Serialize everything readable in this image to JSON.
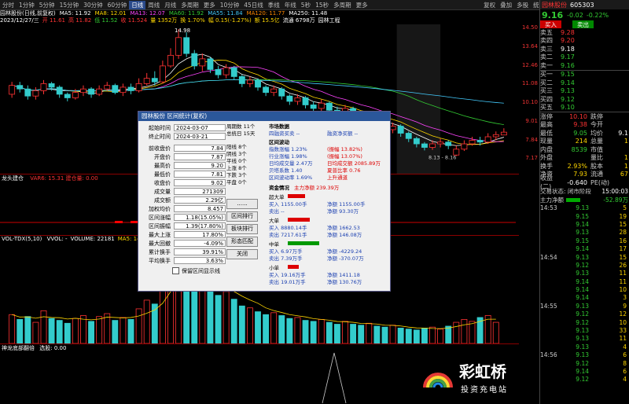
{
  "toolbar": {
    "timeframes": [
      "分时",
      "1分钟",
      "5分钟",
      "15分钟",
      "30分钟",
      "60分钟",
      "日线",
      "周线",
      "月线",
      "多周期",
      "更多"
    ],
    "active_index": 6,
    "middle": [
      "10分钟",
      "45日线",
      "季线",
      "年线",
      "5秒",
      "15秒",
      "多周期",
      "更多"
    ],
    "right_tools": [
      "复权",
      "叠加",
      "多股",
      "统计",
      "画线",
      "F10",
      "标记",
      "自选",
      "返回"
    ]
  },
  "ma_line": {
    "items": [
      {
        "text": "园林股份(日线,前复权)",
        "color": "#ffffff"
      },
      {
        "text": "MA5: 11.92",
        "color": "#ffffff"
      },
      {
        "text": "MA8: 12.01",
        "color": "#ffd700"
      },
      {
        "text": "MA13: 12.07",
        "color": "#ff44ff"
      },
      {
        "text": "MA60: 11.92",
        "color": "#33cc33"
      },
      {
        "text": "MA55: 11.84",
        "color": "#44ccff"
      },
      {
        "text": "MA120: 11.77",
        "color": "#ff8800"
      },
      {
        "text": "MA250: 11.48",
        "color": "#ffffff"
      }
    ]
  },
  "info_line": {
    "date": "2023/12/27/三",
    "items": [
      {
        "text": "开 11.61",
        "color": "#ff3333"
      },
      {
        "text": "高 11.82",
        "color": "#ff3333"
      },
      {
        "text": "低 11.52",
        "color": "#33cc33"
      },
      {
        "text": "收 11.524",
        "color": "#ff3333"
      },
      {
        "text": "量 1352万",
        "color": "#ffd700"
      },
      {
        "text": "换 1.70%",
        "color": "#ffd700"
      },
      {
        "text": "幅 0.15(-1.27%)",
        "color": "#ffd700"
      },
      {
        "text": "额 15.5亿",
        "color": "#ffd700"
      },
      {
        "text": "流通 6798万",
        "color": "#ffffff"
      },
      {
        "text": "园林工程",
        "color": "#ffffff"
      }
    ]
  },
  "price_axis": [
    "14.50",
    "13.64",
    "12.46",
    "11.08",
    "10.10",
    "9.01",
    "7.84",
    "7.17"
  ],
  "annotations": {
    "high_marker": "14.98",
    "low_marker": "8.13 - 8.16"
  },
  "panel2": {
    "title": "龙头建仓",
    "value": "VAR6: 15.31 建仓量: 0.00"
  },
  "panel3": {
    "title": "VOL-TDX(5,10)",
    "values": [
      {
        "text": "VVOL: -",
        "color": "#ffffff"
      },
      {
        "text": "VOLUME: 22181",
        "color": "#ffffff"
      },
      {
        "text": "MA5: 14656",
        "color": "#ffd700"
      },
      {
        "text": "MA10: 19...",
        "color": "#ff44ff"
      }
    ]
  },
  "panel4": {
    "title": "神龙底部翻倍",
    "value": "选股: 0.00"
  },
  "stock": {
    "name": "园林股份",
    "code": "605303",
    "price": "9.16",
    "change": "-0.02",
    "pct": "-0.22%"
  },
  "order_book": {
    "asks": [
      {
        "label": "卖五",
        "price": "9.28",
        "vol": "",
        "color": "#ff3333"
      },
      {
        "label": "卖四",
        "price": "9.20",
        "vol": "",
        "color": "#ff3333"
      },
      {
        "label": "卖三",
        "price": "9.18",
        "vol": "",
        "color": "#ffffff"
      },
      {
        "label": "卖二",
        "price": "9.17",
        "vol": "",
        "color": "#33cc33"
      },
      {
        "label": "卖一",
        "price": "9.16",
        "vol": "",
        "color": "#33cc33"
      }
    ],
    "bids": [
      {
        "label": "买一",
        "price": "9.15",
        "vol": "",
        "color": "#33cc33"
      },
      {
        "label": "买二",
        "price": "9.14",
        "vol": "",
        "color": "#33cc33"
      },
      {
        "label": "买三",
        "price": "9.13",
        "vol": "",
        "color": "#33cc33"
      },
      {
        "label": "买四",
        "price": "9.12",
        "vol": "",
        "color": "#33cc33"
      },
      {
        "label": "买五",
        "price": "9.10",
        "vol": "",
        "color": "#33cc33"
      }
    ]
  },
  "stats": [
    {
      "k": "涨停",
      "v": "10.10",
      "vc": "#ff3333",
      "k2": "跌停",
      "v2": "",
      "v2c": "#33cc33"
    },
    {
      "k": "最高",
      "v": "9.38",
      "vc": "#ff3333",
      "k2": "今开",
      "v2": "",
      "v2c": "#ff3333"
    },
    {
      "k": "最低",
      "v": "9.05",
      "vc": "#33cc33",
      "k2": "均价",
      "v2": "9.1",
      "v2c": "#ffffff"
    },
    {
      "k": "现量",
      "v": "214",
      "vc": "#ffd700",
      "k2": "总量",
      "v2": "1",
      "v2c": "#ffd700"
    },
    {
      "k": "内盘",
      "v": "8539",
      "vc": "#33cc33",
      "k2": "市值",
      "v2": "",
      "v2c": "#ffd700"
    },
    {
      "k": "外盘",
      "v": "",
      "vc": "#ff3333",
      "k2": "量比",
      "v2": "1",
      "v2c": "#ffd700"
    },
    {
      "k": "换手",
      "v": "2.93%",
      "vc": "#ffd700",
      "k2": "股本",
      "v2": "1",
      "v2c": "#ffd700"
    },
    {
      "k": "净资",
      "v": "7.93",
      "vc": "#ffd700",
      "k2": "流通",
      "v2": "67",
      "v2c": "#ffd700"
    },
    {
      "k": "收益(二)",
      "v": "-0.640",
      "vc": "#ffffff",
      "k2": "PE(动)",
      "v2": "",
      "v2c": "#ffffff"
    }
  ],
  "trade_status": {
    "label": "交易状态: 闭市阶段",
    "time": "15:00:03"
  },
  "main_flow": {
    "label": "主力净额",
    "value": "-52.89万"
  },
  "ticks": [
    {
      "t": "14:53",
      "p": "9.13",
      "v": "5"
    },
    {
      "t": "",
      "p": "9.15",
      "v": "19"
    },
    {
      "t": "",
      "p": "9.14",
      "v": "15"
    },
    {
      "t": "",
      "p": "9.13",
      "v": "28"
    },
    {
      "t": "",
      "p": "9.15",
      "v": "16"
    },
    {
      "t": "",
      "p": "9.14",
      "v": "17"
    },
    {
      "t": "14:54",
      "p": "9.13",
      "v": "15"
    },
    {
      "t": "",
      "p": "9.12",
      "v": "26"
    },
    {
      "t": "",
      "p": "9.13",
      "v": "11"
    },
    {
      "t": "",
      "p": "9.14",
      "v": "11"
    },
    {
      "t": "",
      "p": "9.14",
      "v": "10"
    },
    {
      "t": "",
      "p": "9.14",
      "v": "3"
    },
    {
      "t": "14:55",
      "p": "9.13",
      "v": "9"
    },
    {
      "t": "",
      "p": "9.12",
      "v": "12"
    },
    {
      "t": "",
      "p": "9.12",
      "v": "10"
    },
    {
      "t": "",
      "p": "9.13",
      "v": "33"
    },
    {
      "t": "",
      "p": "9.13",
      "v": "11"
    },
    {
      "t": "",
      "p": "9.13",
      "v": "4"
    },
    {
      "t": "14:56",
      "p": "9.13",
      "v": "6"
    },
    {
      "t": "",
      "p": "9.12",
      "v": "8"
    },
    {
      "t": "",
      "p": "9.14",
      "v": "6"
    },
    {
      "t": "",
      "p": "9.12",
      "v": "4"
    }
  ],
  "dialog": {
    "title": "园林股份 区间统计(复权)",
    "fields": [
      {
        "label": "起始时间",
        "value": "2024-03-07"
      },
      {
        "label": "终止时间",
        "value": "2024-03-21"
      }
    ],
    "rows": [
      {
        "label": "前收盘价",
        "value": "7.84"
      },
      {
        "label": "开盘价",
        "value": "7.87"
      },
      {
        "label": "最高价",
        "value": "9.20"
      },
      {
        "label": "最低价",
        "value": "7.81"
      },
      {
        "label": "收盘价",
        "value": "9.02"
      },
      {
        "label": "成交量",
        "value": "271309"
      },
      {
        "label": "成交额",
        "value": "2.29亿"
      },
      {
        "label": "加权均价",
        "value": "8.457"
      },
      {
        "label": "区间涨幅",
        "value": "1.18(15.05%)"
      },
      {
        "label": "区间振幅",
        "value": "1.39(17.80%)"
      },
      {
        "label": "最大上涨",
        "value": "17.80%"
      },
      {
        "label": "最大回撤",
        "value": "-4.09%"
      },
      {
        "label": "累计换手",
        "value": "39.91%"
      },
      {
        "label": "平均换手",
        "value": "3.63%"
      }
    ],
    "checkbox": "保留区间显示线",
    "period": [
      "周期数 11个",
      "总统日 15天"
    ],
    "counts": [
      "阳线 8个",
      "阴线 3个",
      "平线 0个",
      "上涨 8个",
      "下跌 3个",
      "平盘 0个"
    ],
    "buttons": [
      "......",
      "区间排行",
      "板块排行",
      "形态匹配",
      "关闭"
    ],
    "market_title": "市场数据",
    "market_sub": [
      "四融资买卖 --",
      "融资净买额 --"
    ],
    "interval_title": "区间波动",
    "interval": [
      {
        "a": "指数涨幅 1.23%",
        "b": "(振幅 13.82%)"
      },
      {
        "a": "行业涨幅 1.98%",
        "b": "(振幅 13.07%)"
      },
      {
        "a": "日均成交量 2.47万",
        "b": "日均成交额 2085.89万"
      },
      {
        "a": "贝塔系数 1.40",
        "b": "夏普比率 0.76"
      },
      {
        "a": "区间波动率 1.69%",
        "b": "上升通道"
      }
    ],
    "capital_title": "资金情况",
    "capital_main": "主力净额 239.39万",
    "blocks": [
      {
        "name": "超大单",
        "buy": "买入 1155.00手",
        "sell": "卖出 --",
        "net_label": "净额 1155.00手",
        "net2": "净额 93.30万",
        "color": "#dd0000",
        "barw": 22
      },
      {
        "name": "大单",
        "buy": "买入 8880.14手",
        "sell": "卖出 7217.61手",
        "net_label": "净额 1662.53",
        "net2": "净额 146.08万",
        "color": "#dd0000",
        "barw": 28
      },
      {
        "name": "中单",
        "buy": "买入 6.97万手",
        "sell": "卖出 7.39万手",
        "net_label": "净额 -4229.24",
        "net2": "净额 -370.07万",
        "color": "#009900",
        "barw": 40
      },
      {
        "name": "小单",
        "buy": "买入 19.16万手",
        "sell": "卖出 19.01万手",
        "net_label": "净额 1411.18",
        "net2": "净额 130.76万",
        "color": "#dd0000",
        "barw": 14
      }
    ]
  },
  "watermark": {
    "title": "彩虹桥",
    "subtitle": "投资充电站"
  },
  "chart_data": {
    "type": "candlestick",
    "title": "园林股份(日线,前复权)",
    "ylim": [
      7.17,
      14.98
    ],
    "candles": [
      {
        "o": 11.3,
        "c": 11.8,
        "h": 12.0,
        "l": 11.1
      },
      {
        "o": 11.8,
        "c": 11.6,
        "h": 12.0,
        "l": 11.4
      },
      {
        "o": 11.6,
        "c": 11.2,
        "h": 11.8,
        "l": 11.0
      },
      {
        "o": 11.2,
        "c": 11.5,
        "h": 11.7,
        "l": 11.0
      },
      {
        "o": 11.5,
        "c": 11.9,
        "h": 12.1,
        "l": 11.3
      },
      {
        "o": 11.9,
        "c": 11.7,
        "h": 12.0,
        "l": 11.5
      },
      {
        "o": 11.7,
        "c": 11.3,
        "h": 11.8,
        "l": 11.1
      },
      {
        "o": 11.3,
        "c": 11.1,
        "h": 11.4,
        "l": 10.9
      },
      {
        "o": 11.1,
        "c": 11.4,
        "h": 11.6,
        "l": 11.0
      },
      {
        "o": 11.4,
        "c": 11.6,
        "h": 11.8,
        "l": 11.2
      },
      {
        "o": 11.6,
        "c": 11.3,
        "h": 11.7,
        "l": 11.1
      },
      {
        "o": 11.3,
        "c": 11.6,
        "h": 11.8,
        "l": 11.2
      },
      {
        "o": 11.6,
        "c": 11.8,
        "h": 12.0,
        "l": 11.5
      },
      {
        "o": 11.8,
        "c": 11.4,
        "h": 11.9,
        "l": 11.3
      },
      {
        "o": 11.4,
        "c": 11.7,
        "h": 11.9,
        "l": 11.2
      },
      {
        "o": 11.7,
        "c": 11.5,
        "h": 11.9,
        "l": 11.3
      },
      {
        "o": 11.5,
        "c": 11.9,
        "h": 12.2,
        "l": 11.4
      },
      {
        "o": 11.9,
        "c": 12.2,
        "h": 12.5,
        "l": 11.8
      },
      {
        "o": 12.2,
        "c": 12.0,
        "h": 12.6,
        "l": 11.8
      },
      {
        "o": 12.0,
        "c": 12.9,
        "h": 13.2,
        "l": 11.9
      },
      {
        "o": 12.9,
        "c": 13.5,
        "h": 13.9,
        "l": 12.8
      },
      {
        "o": 13.5,
        "c": 14.5,
        "h": 14.98,
        "l": 13.3
      },
      {
        "o": 14.5,
        "c": 13.6,
        "h": 14.8,
        "l": 13.4
      },
      {
        "o": 13.6,
        "c": 12.9,
        "h": 13.8,
        "l": 12.7
      },
      {
        "o": 12.9,
        "c": 13.3,
        "h": 13.6,
        "l": 12.6
      },
      {
        "o": 13.3,
        "c": 12.7,
        "h": 13.4,
        "l": 12.5
      },
      {
        "o": 12.7,
        "c": 12.4,
        "h": 12.9,
        "l": 12.2
      },
      {
        "o": 12.4,
        "c": 12.8,
        "h": 13.0,
        "l": 12.2
      },
      {
        "o": 12.8,
        "c": 12.3,
        "h": 12.9,
        "l": 12.1
      },
      {
        "o": 12.3,
        "c": 11.9,
        "h": 12.4,
        "l": 11.7
      },
      {
        "o": 11.9,
        "c": 12.1,
        "h": 12.3,
        "l": 11.7
      },
      {
        "o": 12.1,
        "c": 11.7,
        "h": 12.2,
        "l": 11.5
      },
      {
        "o": 11.7,
        "c": 11.4,
        "h": 11.8,
        "l": 11.2
      },
      {
        "o": 11.4,
        "c": 11.6,
        "h": 11.8,
        "l": 11.2
      },
      {
        "o": 11.6,
        "c": 11.2,
        "h": 11.7,
        "l": 11.0
      },
      {
        "o": 11.2,
        "c": 10.9,
        "h": 11.3,
        "l": 10.7
      },
      {
        "o": 10.9,
        "c": 11.1,
        "h": 11.3,
        "l": 10.7
      },
      {
        "o": 11.1,
        "c": 10.7,
        "h": 11.2,
        "l": 10.5
      },
      {
        "o": 10.7,
        "c": 10.5,
        "h": 10.9,
        "l": 10.3
      },
      {
        "o": 10.5,
        "c": 10.8,
        "h": 11.0,
        "l": 10.3
      },
      {
        "o": 10.8,
        "c": 10.4,
        "h": 10.9,
        "l": 10.2
      },
      {
        "o": 10.4,
        "c": 10.2,
        "h": 10.6,
        "l": 10.0
      },
      {
        "o": 10.2,
        "c": 10.5,
        "h": 10.7,
        "l": 10.0
      },
      {
        "o": 10.5,
        "c": 10.1,
        "h": 10.6,
        "l": 9.9
      },
      {
        "o": 10.1,
        "c": 9.8,
        "h": 10.2,
        "l": 9.6
      },
      {
        "o": 9.8,
        "c": 10.0,
        "h": 10.2,
        "l": 9.6
      },
      {
        "o": 10.0,
        "c": 9.6,
        "h": 10.1,
        "l": 9.4
      },
      {
        "o": 9.6,
        "c": 9.3,
        "h": 9.8,
        "l": 9.1
      },
      {
        "o": 9.3,
        "c": 9.5,
        "h": 9.7,
        "l": 9.1
      },
      {
        "o": 9.5,
        "c": 9.1,
        "h": 9.6,
        "l": 8.9
      },
      {
        "o": 9.1,
        "c": 8.8,
        "h": 9.2,
        "l": 8.6
      },
      {
        "o": 8.8,
        "c": 8.5,
        "h": 8.9,
        "l": 8.3
      },
      {
        "o": 8.5,
        "c": 8.3,
        "h": 8.6,
        "l": 8.13
      },
      {
        "o": 8.3,
        "c": 8.5,
        "h": 8.7,
        "l": 8.16
      },
      {
        "o": 8.5,
        "c": 8.6,
        "h": 8.8,
        "l": 8.3
      },
      {
        "o": 8.6,
        "c": 8.4,
        "h": 8.7,
        "l": 8.2
      },
      {
        "o": 7.87,
        "c": 8.2,
        "h": 8.4,
        "l": 7.81
      },
      {
        "o": 8.2,
        "c": 8.5,
        "h": 8.7,
        "l": 8.1
      },
      {
        "o": 8.5,
        "c": 8.7,
        "h": 8.9,
        "l": 8.4
      },
      {
        "o": 8.7,
        "c": 8.6,
        "h": 8.9,
        "l": 8.4
      },
      {
        "o": 8.6,
        "c": 8.9,
        "h": 9.1,
        "l": 8.5
      },
      {
        "o": 8.9,
        "c": 9.02,
        "h": 9.2,
        "l": 8.7
      },
      {
        "o": 9.0,
        "c": 9.16,
        "h": 9.38,
        "l": 9.05
      }
    ],
    "volumes": [
      3,
      2.5,
      2.8,
      2.2,
      3.4,
      2.6,
      2.4,
      2.1,
      2.6,
      2.9,
      2.3,
      2.8,
      3.1,
      2.4,
      2.7,
      2.5,
      3.6,
      4.5,
      4.1,
      6.2,
      8.5,
      9.8,
      8.7,
      7.1,
      6.3,
      5.7,
      5.0,
      5.4,
      4.6,
      3.9,
      3.7,
      3.3,
      3.0,
      3.2,
      2.9,
      2.6,
      2.7,
      2.4,
      2.3,
      2.5,
      2.2,
      2.0,
      2.3,
      2.0,
      1.9,
      2.1,
      1.8,
      1.7,
      1.9,
      1.6,
      1.5,
      1.4,
      1.6,
      1.7,
      1.5,
      1.8,
      2.2,
      2.5,
      2.3,
      2.7,
      2.9,
      2.2
    ]
  }
}
